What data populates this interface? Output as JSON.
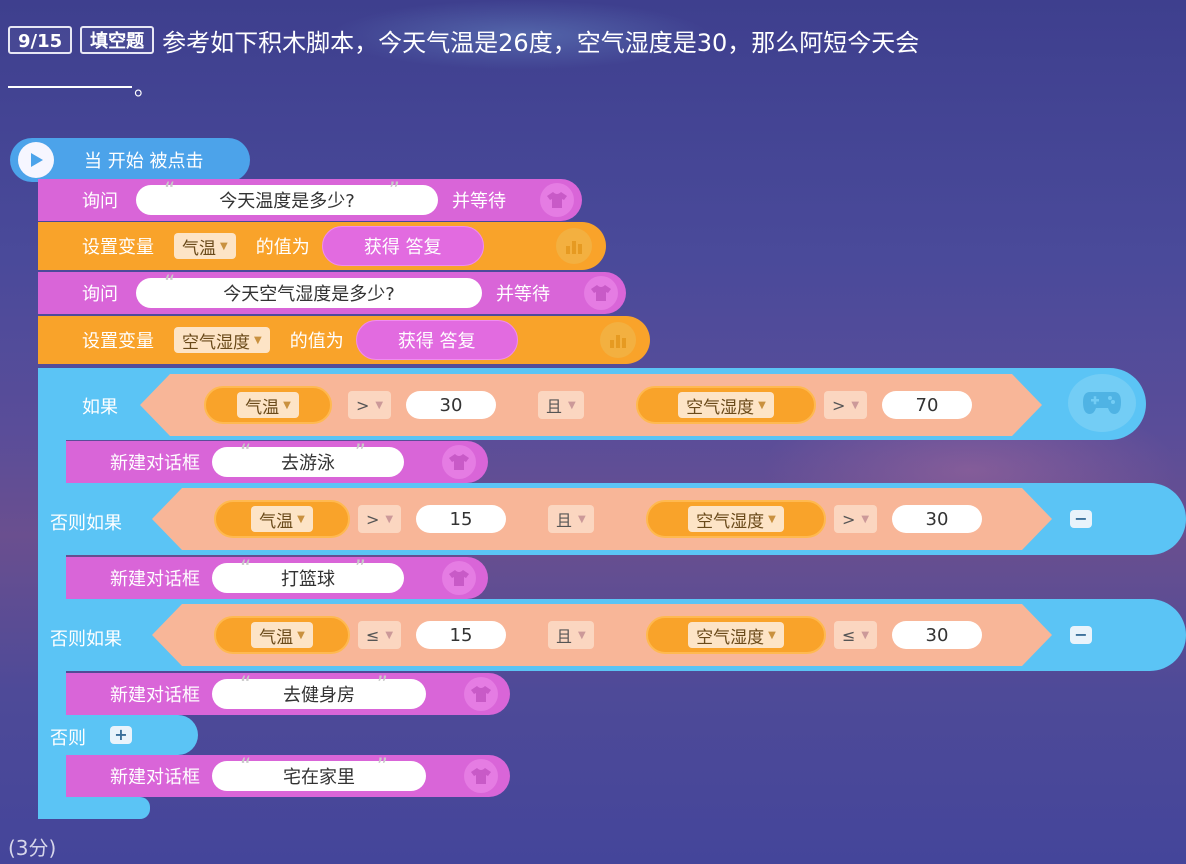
{
  "header": {
    "progress": "9/15",
    "type": "填空题",
    "question": "参考如下积木脚本，今天气温是26度，空气湿度是30，那么阿短今天会",
    "period": "。"
  },
  "score": "(3分)",
  "script": {
    "hat": "当 开始 被点击",
    "ask1": {
      "label": "询问",
      "text": "今天温度是多少?",
      "wait": "并等待"
    },
    "set1": {
      "label": "设置变量",
      "var": "气温",
      "value_label": "的值为",
      "reporter": "获得 答复"
    },
    "ask2": {
      "label": "询问",
      "text": "今天空气湿度是多少?",
      "wait": "并等待"
    },
    "set2": {
      "label": "设置变量",
      "var": "空气湿度",
      "value_label": "的值为",
      "reporter": "获得 答复"
    },
    "if1": {
      "label": "如果",
      "var1": "气温",
      "op1": ">",
      "val1": "30",
      "and": "且",
      "var2": "空气湿度",
      "op2": ">",
      "val2": "70"
    },
    "say1": {
      "label": "新建对话框",
      "text": "去游泳"
    },
    "elif1": {
      "label": "否则如果",
      "var1": "气温",
      "op1": ">",
      "val1": "15",
      "and": "且",
      "var2": "空气湿度",
      "op2": ">",
      "val2": "30"
    },
    "say2": {
      "label": "新建对话框",
      "text": "打篮球"
    },
    "elif2": {
      "label": "否则如果",
      "var1": "气温",
      "op1": "≤",
      "val1": "15",
      "and": "且",
      "var2": "空气湿度",
      "op2": "≤",
      "val2": "30"
    },
    "say3": {
      "label": "新建对话框",
      "text": "去健身房"
    },
    "else": {
      "label": "否则"
    },
    "say4": {
      "label": "新建对话框",
      "text": "宅在家里"
    },
    "open_quote": "“",
    "close_quote": "”",
    "minus": "−",
    "plus": "+",
    "arrow": "▼"
  },
  "colors": {
    "event": "#4ca3ea",
    "looks": "#d965d8",
    "data": "#f9a32a",
    "control": "#5bc4f5",
    "operator": "#f8b698"
  },
  "icons": [
    "play-icon",
    "shirt-icon",
    "chart-icon",
    "gamepad-icon"
  ]
}
